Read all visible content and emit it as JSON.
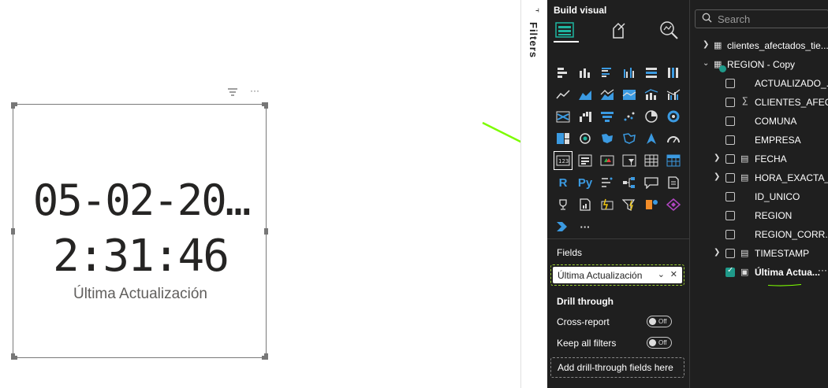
{
  "card": {
    "date": "05-02-20…",
    "time": "2:31:46",
    "label": "Última Actualización",
    "header_icons": [
      "filter-icon",
      "more-options-icon"
    ]
  },
  "filters_pane": {
    "title": "Filters"
  },
  "build_visual": {
    "title": "Build visual",
    "fields_section": "Fields",
    "field_value": "Última Actualización",
    "drill_through": "Drill through",
    "cross_report": "Cross-report",
    "cross_report_toggle": "Off",
    "keep_all_filters": "Keep all filters",
    "keep_all_filters_toggle": "Off",
    "add_drill_through": "Add drill-through fields here",
    "visual_icons": {
      "r_visual": "R",
      "python_visual": "Py",
      "more": "···"
    }
  },
  "data_pane": {
    "search_placeholder": "Search",
    "tables": [
      {
        "name": "clientes_afectados_tie..."
      },
      {
        "name": "REGION - Copy"
      }
    ],
    "fields": [
      {
        "name": "ACTUALIZADO_...",
        "icon": ""
      },
      {
        "name": "CLIENTES_AFEC...",
        "icon": "∑"
      },
      {
        "name": "COMUNA",
        "icon": ""
      },
      {
        "name": "EMPRESA",
        "icon": ""
      },
      {
        "name": "FECHA",
        "icon": "calendar-icon"
      },
      {
        "name": "HORA_EXACTA_...",
        "icon": "calendar-icon"
      },
      {
        "name": "ID_UNICO",
        "icon": ""
      },
      {
        "name": "REGION",
        "icon": ""
      },
      {
        "name": "REGION_CORR...",
        "icon": ""
      },
      {
        "name": "TIMESTAMP",
        "icon": "calendar-icon"
      },
      {
        "name": "Última Actua...",
        "icon": "measure-icon"
      }
    ],
    "more": "···"
  },
  "colors": {
    "accent_green": "#7cfc00",
    "pane_bg": "#1f1f1f",
    "check_teal": "#1f9a8a"
  }
}
